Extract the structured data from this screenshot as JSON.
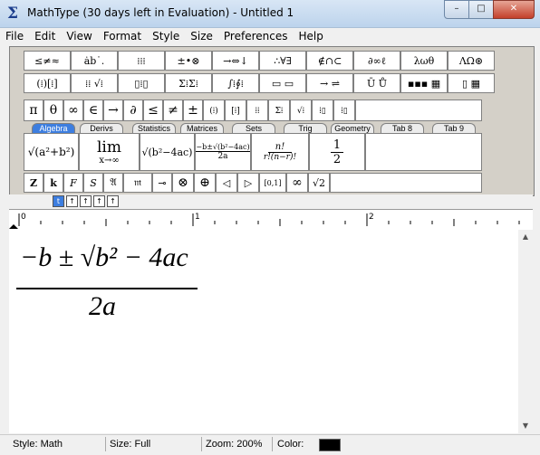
{
  "window": {
    "title": "MathType (30 days left in Evaluation) - Untitled 1",
    "app_icon": "sigma-icon",
    "min_glyph": "–",
    "max_glyph": "□",
    "close_glyph": "✕"
  },
  "menu": [
    "File",
    "Edit",
    "View",
    "Format",
    "Style",
    "Size",
    "Preferences",
    "Help"
  ],
  "symbol_row1": [
    "≤≠≈",
    "ȧb˙.",
    "⁞⁞⁞",
    "±•⊗",
    "→⇔↓",
    "∴∀∃",
    "∉∩⊂",
    "∂∞ℓ",
    "λωθ",
    "ΛΩ⊛"
  ],
  "symbol_row2": [
    "(⁞)[⁞]",
    "⁞⁞ √⁞",
    "▯⁞▯",
    "Σ⁞Σ⁞",
    "∫⁞∮⁞",
    "▭ ▭",
    "→ ⇌",
    "Ū Ů",
    "▪▪▪ ▦",
    "▯ ▦"
  ],
  "small_row": [
    "π",
    "θ",
    "∞",
    "∈",
    "→",
    "∂",
    "≤",
    "≠",
    "±",
    "(⁞)",
    "[⁞]",
    "⁞⁞",
    "Σ⁞",
    "√⁞",
    "⁞▯",
    "⁞▯"
  ],
  "tabs": [
    "Algebra",
    "Derivs",
    "Statistics",
    "Matrices",
    "Sets",
    "Trig",
    "Geometry",
    "Tab 8",
    "Tab 9"
  ],
  "templates": {
    "t1": "√(a²+b²)",
    "t2_top": "lim",
    "t2_bottom": "x→∞",
    "t3": "√(b²−4ac)",
    "t4_top": "−b±√(b²−4ac)",
    "t4_bottom": "2a",
    "t5_top": "n!",
    "t5_bottom": "r!(n−r)!",
    "t6_top": "1",
    "t6_bottom": "2"
  },
  "bottom_row": [
    "Z",
    "k",
    "F",
    "S",
    "𝔄",
    "𝔪",
    "⊸",
    "⊗",
    "⊕",
    "◁",
    "▷",
    "[0,1]",
    "∞",
    "√2"
  ],
  "size_buttons": [
    "t",
    "↑",
    "↑",
    "↑",
    "↑"
  ],
  "ruler": {
    "mark0": "0",
    "mark1": "1",
    "mark2": "2"
  },
  "equation": {
    "numerator": "−b ± √b² − 4ac",
    "denominator": "2a"
  },
  "status": {
    "style": "Style: Math",
    "size": "Size: Full",
    "zoom": "Zoom: 200%",
    "color_label": "Color:",
    "color": "#000000"
  }
}
